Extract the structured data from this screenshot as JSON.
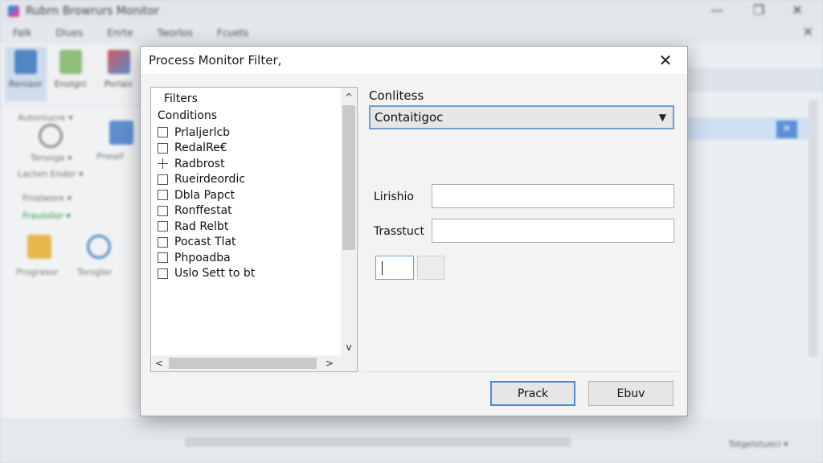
{
  "background_window": {
    "title": "Rubrn Browrurs Monitor",
    "menu": [
      "Falk",
      "Dlues",
      "Enrte",
      "Tworlos",
      "Fcuets"
    ],
    "ribbon": [
      "Reniaor",
      "Enolgrc",
      "Porlaic"
    ],
    "left_labels": [
      "Autoniucre ▾",
      "Tersnge ▾",
      "Lacten Ender ▾",
      "Finalwore ▾",
      "Fraulollor ▾",
      "Prograsor",
      "Torsglor"
    ],
    "side_labels": [
      "Pnealf"
    ],
    "status_label": "Totgelstueci ▾"
  },
  "dialog": {
    "title": "Process Monitor Filter,",
    "close_symbol": "✕",
    "filter_list": {
      "header": "Filters",
      "subheader": "Conditions",
      "items": [
        {
          "label": "Prlaljerlcb",
          "marker": "box"
        },
        {
          "label": "RedalRe€",
          "marker": "box"
        },
        {
          "label": "Radbrost",
          "marker": "plus"
        },
        {
          "label": "Rueirdeordic",
          "marker": "box"
        },
        {
          "label": "Dbla Papct",
          "marker": "box"
        },
        {
          "label": "Ronffestat",
          "marker": "box"
        },
        {
          "label": "Rad Relbt",
          "marker": "box"
        },
        {
          "label": "Pocast Tlat",
          "marker": "box"
        },
        {
          "label": "Phpoadba",
          "marker": "box"
        },
        {
          "label": "Uslo Sett to bt",
          "marker": "box"
        }
      ],
      "scroll_up": "^",
      "scroll_down": "v",
      "scroll_left": "<",
      "scroll_right": ">"
    },
    "conditions": {
      "label": "Conlitess",
      "selected": "Contaitigoc",
      "arrow": "▼"
    },
    "field1": {
      "label": "Lirishio",
      "value": ""
    },
    "field2": {
      "label": "Trasstuct",
      "value": ""
    },
    "buttons": {
      "primary": "Prack",
      "secondary": "Ebuv"
    }
  }
}
